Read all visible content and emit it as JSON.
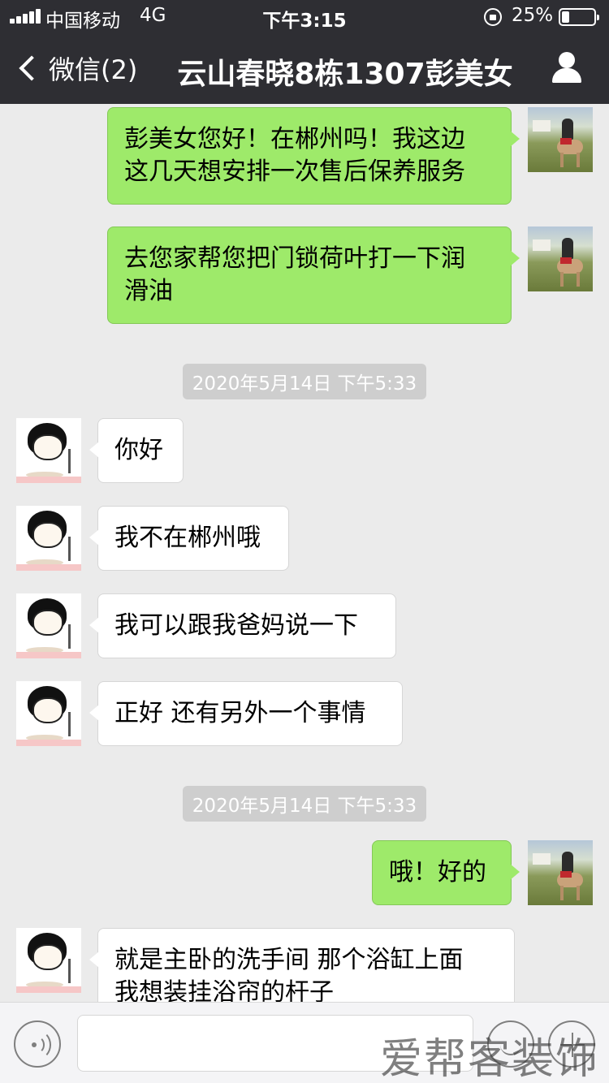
{
  "status_bar": {
    "carrier": "中国移动",
    "network": "4G",
    "time": "下午3:15",
    "battery": "25%"
  },
  "nav": {
    "back_label": "微信(2)",
    "title": "云山春晓8栋1307彭美女"
  },
  "messages": [
    {
      "sender": "me",
      "text_lines": [
        "彭美女您好！在郴州吗！我这边",
        "这几天想安排一次售后保养服务"
      ]
    },
    {
      "sender": "me",
      "text_lines": [
        "去您家帮您把门锁荷叶打一下润",
        "滑油"
      ]
    },
    {
      "timestamp": "2020年5月14日 下午5:33"
    },
    {
      "sender": "them",
      "text_lines": [
        "你好"
      ]
    },
    {
      "sender": "them",
      "text_lines": [
        "我不在郴州哦"
      ]
    },
    {
      "sender": "them",
      "text_lines": [
        "我可以跟我爸妈说一下"
      ]
    },
    {
      "sender": "them",
      "text_lines": [
        "正好 还有另外一个事情"
      ]
    },
    {
      "timestamp": "2020年5月14日 下午5:33"
    },
    {
      "sender": "me",
      "text_lines": [
        "哦！好的"
      ]
    },
    {
      "sender": "them",
      "text_lines": [
        "就是主卧的洗手间 那个浴缸上面",
        "我想装挂浴帘的杆子"
      ]
    }
  ],
  "input": {
    "placeholder": ""
  },
  "watermark": "爱帮客装饰",
  "colors": {
    "nav_bg": "#2e2e33",
    "chat_bg": "#ebebeb",
    "my_bubble": "#9eea6a",
    "their_bubble": "#ffffff",
    "timestamp_bg": "#cecece"
  }
}
